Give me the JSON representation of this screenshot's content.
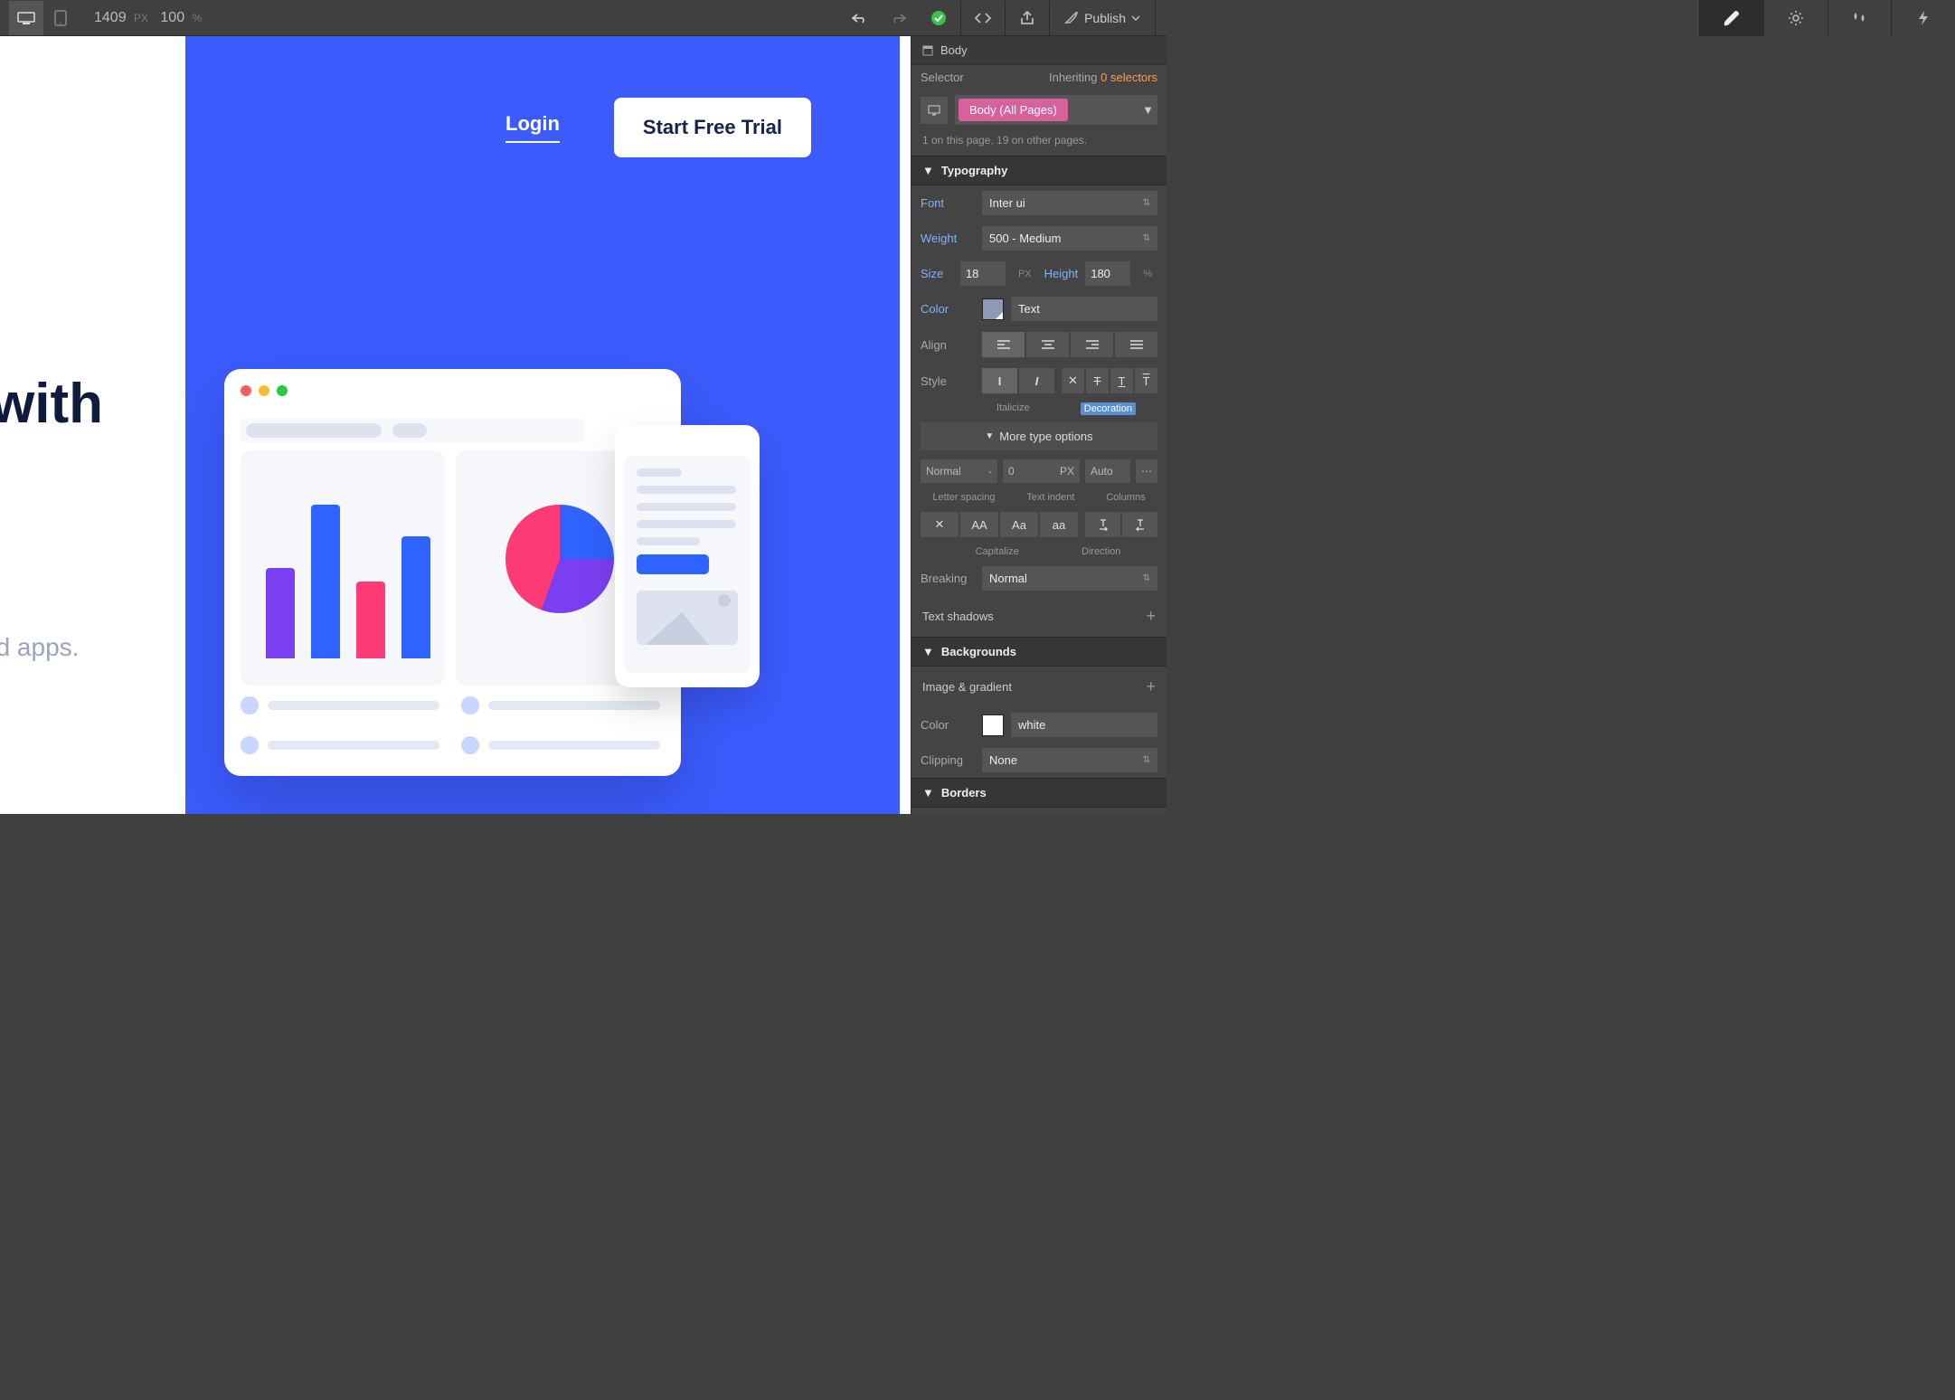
{
  "topbar": {
    "width_value": "1409",
    "width_unit": "PX",
    "zoom_value": "100",
    "zoom_unit": "%",
    "publish_label": "Publish"
  },
  "canvas": {
    "nav": {
      "login": "Login",
      "trial": "Start Free Trial"
    },
    "headline_line1": "with",
    "headline_line2": "",
    "subhead": "nd apps."
  },
  "panel": {
    "crumb": "Body",
    "selector_label": "Selector",
    "inheriting_label": "Inheriting",
    "inheriting_count": "0 selectors",
    "selector_pill": "Body (All Pages)",
    "selector_note": "1 on this page, 19 on other pages.",
    "typography": {
      "title": "Typography",
      "font_label": "Font",
      "font_value": "Inter ui",
      "weight_label": "Weight",
      "weight_value": "500 - Medium",
      "size_label": "Size",
      "size_value": "18",
      "size_unit": "PX",
      "height_label": "Height",
      "height_value": "180",
      "height_unit": "%",
      "color_label": "Color",
      "color_value": "Text",
      "align_label": "Align",
      "style_label": "Style",
      "italicize_label": "Italicize",
      "decoration_label": "Decoration",
      "more_label": "More type options",
      "letterspacing_value": "Normal",
      "letterspacing_unit": "-",
      "indent_value": "0",
      "indent_unit": "PX",
      "columns_value": "Auto",
      "letterspacing_label": "Letter spacing",
      "textindent_label": "Text indent",
      "columns_label": "Columns",
      "capitalize_label": "Capitalize",
      "direction_label": "Direction",
      "breaking_label": "Breaking",
      "breaking_value": "Normal",
      "shadows_label": "Text shadows"
    },
    "backgrounds": {
      "title": "Backgrounds",
      "image_label": "Image & gradient",
      "color_label": "Color",
      "color_value": "white",
      "clipping_label": "Clipping",
      "clipping_value": "None"
    },
    "borders": {
      "title": "Borders"
    }
  }
}
